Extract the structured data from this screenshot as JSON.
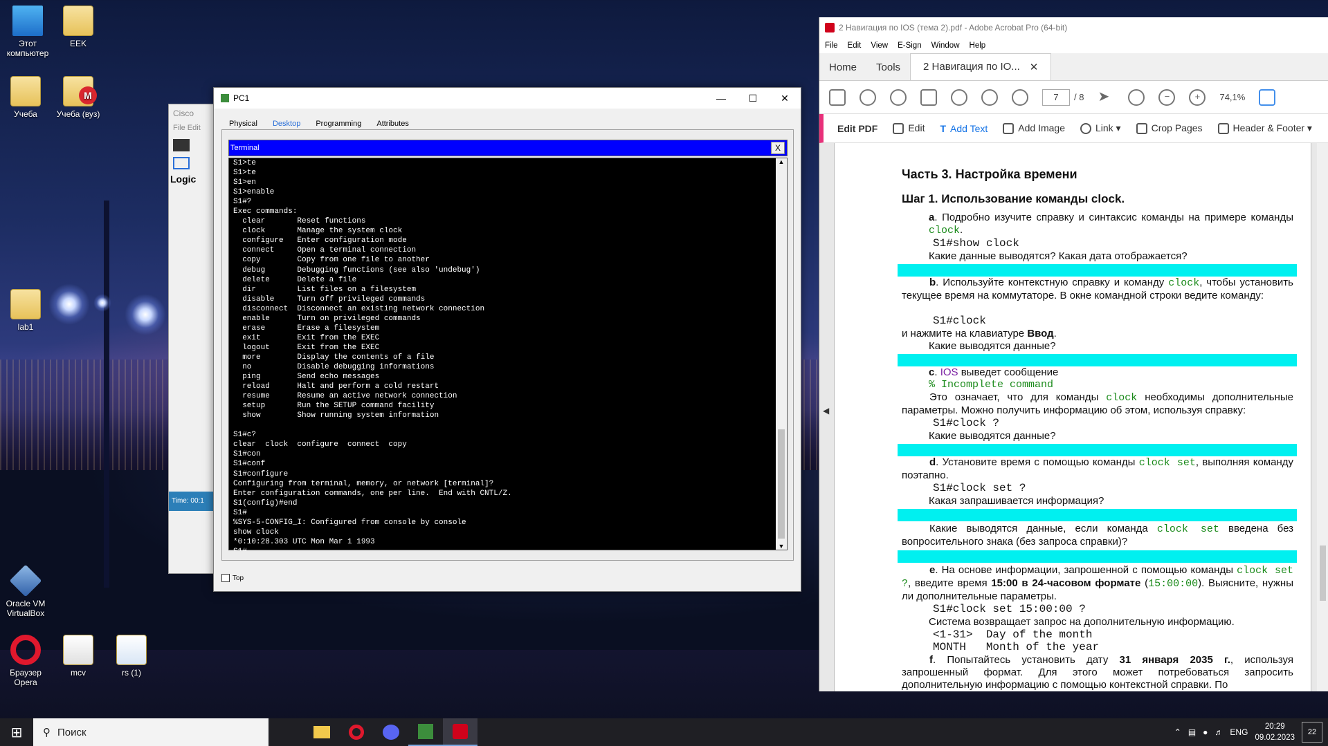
{
  "desktop_icons": [
    {
      "label": "Этот компьютер",
      "icon": "this-pc-icon"
    },
    {
      "label": "EEK",
      "icon": "folder-icon"
    },
    {
      "label": "Учеба",
      "icon": "folder-icon"
    },
    {
      "label": "Учеба (вуз)",
      "icon": "mega-folder-icon"
    },
    {
      "label": "lab1",
      "icon": "folder-icon"
    },
    {
      "label": "Oracle VM VirtualBox",
      "icon": "virtualbox-icon"
    },
    {
      "label": "Браузер Opera",
      "icon": "opera-icon"
    },
    {
      "label": "mcv",
      "icon": "file-icon"
    },
    {
      "label": "rs (1)",
      "icon": "packet-tracer-file-icon"
    }
  ],
  "packet_tracer": {
    "title": "Cisco",
    "menu_file": "File",
    "menu_edit": "Edit",
    "logical_tab": "Logic",
    "time": "Time: 00:1"
  },
  "pc1": {
    "title": "PC1",
    "tabs": [
      "Physical",
      "Desktop",
      "Programming",
      "Attributes"
    ],
    "active_tab": "Desktop",
    "terminal_title": "Terminal",
    "terminal_close": "X",
    "top_checkbox_label": "Top",
    "terminal_text": "S1>te\nS1>te\nS1>en\nS1>enable\nS1#?\nExec commands:\n  clear       Reset functions\n  clock       Manage the system clock\n  configure   Enter configuration mode\n  connect     Open a terminal connection\n  copy        Copy from one file to another\n  debug       Debugging functions (see also 'undebug')\n  delete      Delete a file\n  dir         List files on a filesystem\n  disable     Turn off privileged commands\n  disconnect  Disconnect an existing network connection\n  enable      Turn on privileged commands\n  erase       Erase a filesystem\n  exit        Exit from the EXEC\n  logout      Exit from the EXEC\n  more        Display the contents of a file\n  no          Disable debugging informations\n  ping        Send echo messages\n  reload      Halt and perform a cold restart\n  resume      Resume an active network connection\n  setup       Run the SETUP command facility\n  show        Show running system information\n\nS1#c?\nclear  clock  configure  connect  copy\nS1#con\nS1#conf\nS1#configure\nConfiguring from terminal, memory, or network [terminal]?\nEnter configuration commands, one per line.  End with CNTL/Z.\nS1(config)#end\nS1#\n%SYS-5-CONFIG_I: Configured from console by console\nshow clock\n*0:10:28.303 UTC Mon Mar 1 1993\nS1#"
  },
  "acrobat": {
    "title": "2 Навигация по IOS (тема 2).pdf - Adobe Acrobat Pro (64-bit)",
    "menu": [
      "File",
      "Edit",
      "View",
      "E-Sign",
      "Window",
      "Help"
    ],
    "tabs": {
      "home": "Home",
      "tools": "Tools",
      "doc": "2 Навигация по IO...",
      "doc_close": "✕"
    },
    "page_current": "7",
    "page_total": "/ 8",
    "zoom": "74,1%",
    "edit_toolbar": {
      "title": "Edit PDF",
      "edit": "Edit",
      "add_text": "Add Text",
      "add_image": "Add Image",
      "link": "Link",
      "crop": "Crop Pages",
      "header_footer": "Header & Footer"
    },
    "page": {
      "part_title": "Часть 3. Настройка времени",
      "step_title": "Шаг 1. Использование команды clock.",
      "a_label": "a",
      "a_text": ". Подробно изучите справку и синтаксис команды на примере команды ",
      "a_cmd": "clock",
      "a_end": ".",
      "show_clock": "S1#show clock",
      "q1": "Какие данные выводятся? Какая дата отображается?",
      "b_label": "b",
      "b_text1": ". Используйте контекстную справку и команду ",
      "b_cmd": "clock",
      "b_text2": ", чтобы установить текущее время на коммутаторе. В окне командной строки ведите команду:",
      "s1_clock": "S1#clock",
      "enter_text1": "и нажмите на клавиатуре ",
      "enter_key": "Ввод",
      "enter_end": ".",
      "q2": "Какие выводятся данные?",
      "c_label": "c",
      "c_ios": "IOS",
      "c_text": " выведет сообщение",
      "incomplete": "% Incomplete command",
      "c_expl1": "Это означает, что для команды ",
      "c_expl_cmd": "clock",
      "c_expl2": " необходимы дополнительные параметры. Можно получить информацию об этом, используя справку:",
      "s1_clock_q": "S1#clock ?",
      "q3": "Какие выводятся данные?",
      "d_label": "d",
      "d_text1": ". Установите время с помощью команды ",
      "d_cmd": "clock set",
      "d_text2": ", выполняя команду поэтапно.",
      "s1_clock_set_q": "S1#clock set ?",
      "q4": "Какая запрашивается информация?",
      "q5a": "Какие выводятся данные, если команда ",
      "q5_cmd": "clock set",
      "q5b": " введена без вопросительного знака (без запроса справки)?",
      "e_label": "e",
      "e_text1": ". На основе информации, запрошенной с помощью команды ",
      "e_cmd": "clock set ?",
      "e_text2": ", введите время ",
      "e_bold": "15:00 в 24-часовом формате",
      "e_text3": " (",
      "e_time": "15:00:00",
      "e_text4": "). Выясните, нужны ли дополнительные параметры.",
      "s1_clock_set_15": "S1#clock set 15:00:00 ?",
      "sys_returns": "Система возвращает запрос на дополнительную информацию.",
      "day_line": "<1-31>  Day of the month",
      "month_line": "MONTH   Month of the year",
      "f_label": "f",
      "f_text1": ". Попытайтесь установить дату ",
      "f_bold": "31 января 2035 г.",
      "f_text2": ", используя запрошенный формат. Для этого может потребоваться запросить дополнительную информацию с помощью контекстной справки. По"
    }
  },
  "taskbar": {
    "search_placeholder": "Поиск",
    "lang": "ENG",
    "time": "20:29",
    "date": "09.02.2023",
    "notifications": "22"
  },
  "colors": {
    "highlight": "#00f0f0",
    "terminal_bar": "#0000ff",
    "accent": "#1473e6",
    "edit_pdf_marker": "#e8307a"
  }
}
